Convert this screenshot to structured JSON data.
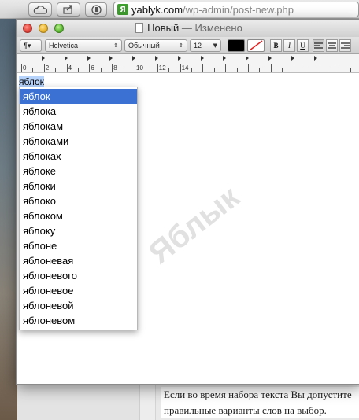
{
  "browser": {
    "url_host": "yablyk.com",
    "url_path": "/wp-admin/post-new.php",
    "favicon_letter": "Я"
  },
  "window": {
    "title_main": "Новый",
    "title_sep": " — ",
    "title_status": "Изменено"
  },
  "toolbar": {
    "paragraph_menu": "¶▾",
    "font_family": "Helvetica",
    "font_style": "Обычный",
    "font_size": "12",
    "bold": "B",
    "italic": "I",
    "underline": "U",
    "text_color": "#000000"
  },
  "ruler": {
    "labels": [
      "0",
      "2",
      "4",
      "6",
      "8",
      "10",
      "12",
      "14"
    ]
  },
  "document": {
    "typed_text": "яблок"
  },
  "autocomplete": {
    "items": [
      "яблок",
      "яблока",
      "яблокам",
      "яблоками",
      "яблоках",
      "яблоке",
      "яблоки",
      "яблоко",
      "яблоком",
      "яблоку",
      "яблоне",
      "яблоневая",
      "яблоневого",
      "яблоневое",
      "яблоневой",
      "яблоневом"
    ],
    "selected_index": 0
  },
  "watermark": "Яблык",
  "page_below": {
    "line1": "Если во время набора текста Вы допустите",
    "line2": "правильные варианты слов на выбор."
  }
}
